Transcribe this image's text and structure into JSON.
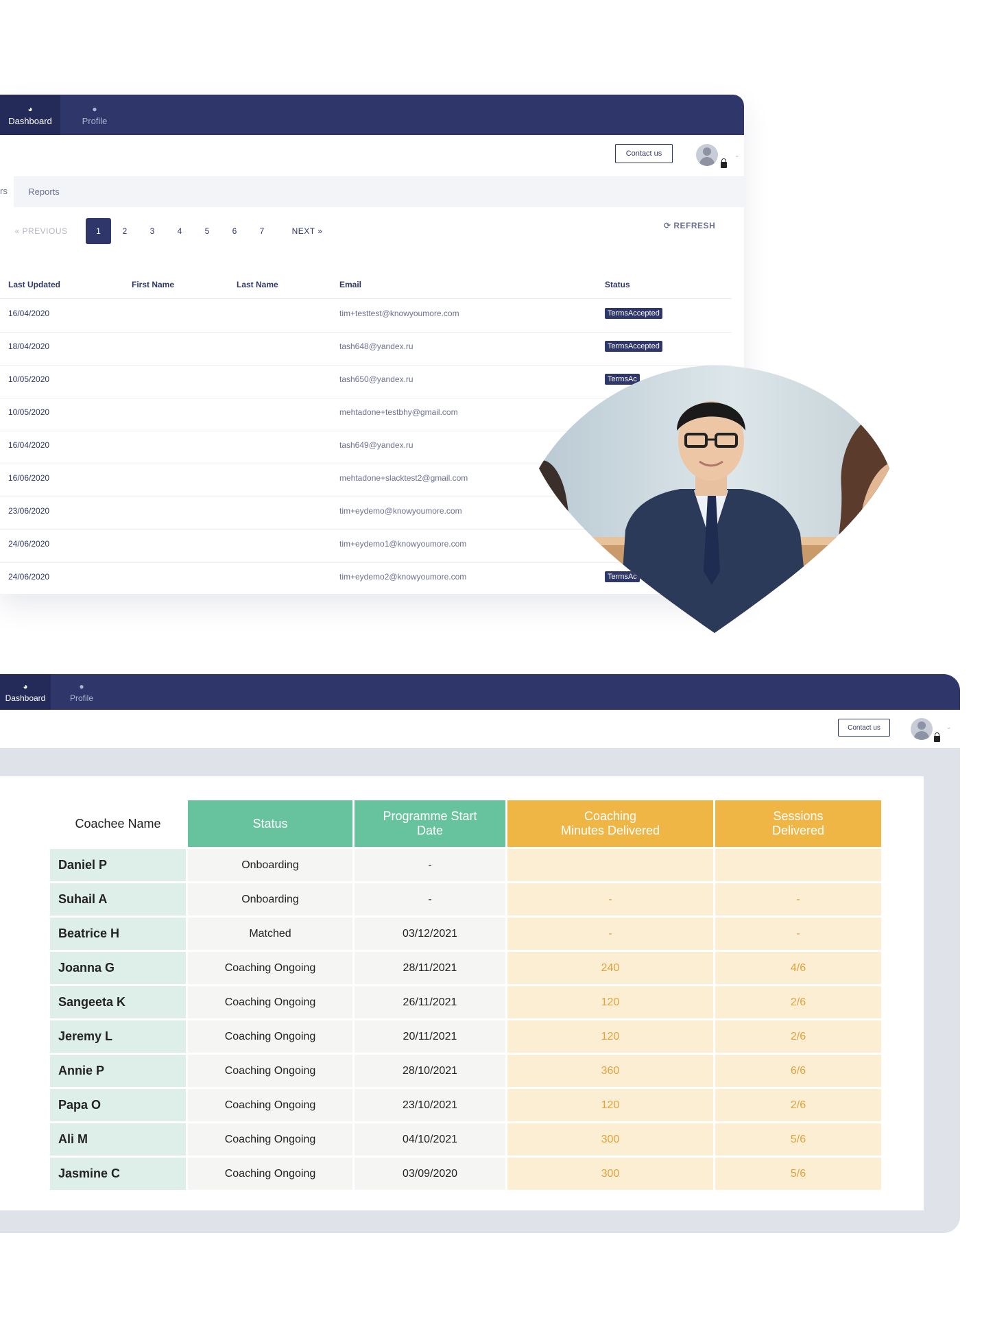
{
  "admin": {
    "nav": {
      "dashboard": "Dashboard",
      "profile": "Profile"
    },
    "header": {
      "contact": "Contact us"
    },
    "tabs": {
      "left_partial": "rs",
      "reports": "Reports"
    },
    "pager": {
      "prev": "«  PREVIOUS",
      "pages": [
        "1",
        "2",
        "3",
        "4",
        "5",
        "6",
        "7"
      ],
      "next": "NEXT  »",
      "refresh": "⟳ REFRESH"
    },
    "columns": [
      "Last Updated",
      "First Name",
      "Last Name",
      "Email",
      "Status"
    ],
    "rows": [
      {
        "date": "16/04/2020",
        "email": "tim+testtest@knowyoumore.com",
        "status": "TermsAccepted"
      },
      {
        "date": "18/04/2020",
        "email": "tash648@yandex.ru",
        "status": "TermsAccepted"
      },
      {
        "date": "10/05/2020",
        "email": "tash650@yandex.ru",
        "status": "TermsAc"
      },
      {
        "date": "10/05/2020",
        "email": "mehtadone+testbhy@gmail.com",
        "status": ""
      },
      {
        "date": "16/04/2020",
        "email": "tash649@yandex.ru",
        "status": ""
      },
      {
        "date": "16/06/2020",
        "email": "mehtadone+slacktest2@gmail.com",
        "status": ""
      },
      {
        "date": "23/06/2020",
        "email": "tim+eydemo@knowyoumore.com",
        "status": ""
      },
      {
        "date": "24/06/2020",
        "email": "tim+eydemo1@knowyoumore.com",
        "status": ""
      },
      {
        "date": "24/06/2020",
        "email": "tim+eydemo2@knowyoumore.com",
        "status": "TermsAc"
      }
    ]
  },
  "coach": {
    "nav": {
      "dashboard": "Dashboard",
      "profile": "Profile"
    },
    "header": {
      "contact": "Contact us"
    },
    "columns": {
      "name": "Coachee Name",
      "status": "Status",
      "start_1": "Programme Start",
      "start_2": "Date",
      "minutes_1": "Coaching",
      "minutes_2": "Minutes Delivered",
      "sessions_1": "Sessions",
      "sessions_2": "Delivered"
    },
    "rows": [
      {
        "name": "Daniel P",
        "status": "Onboarding",
        "start": "-",
        "minutes": "",
        "sessions": ""
      },
      {
        "name": "Suhail A",
        "status": "Onboarding",
        "start": "-",
        "minutes": "-",
        "sessions": "-"
      },
      {
        "name": "Beatrice H",
        "status": "Matched",
        "start": "03/12/2021",
        "minutes": "-",
        "sessions": "-"
      },
      {
        "name": "Joanna G",
        "status": "Coaching Ongoing",
        "start": "28/11/2021",
        "minutes": "240",
        "sessions": "4/6"
      },
      {
        "name": "Sangeeta K",
        "status": "Coaching Ongoing",
        "start": "26/11/2021",
        "minutes": "120",
        "sessions": "2/6"
      },
      {
        "name": "Jeremy L",
        "status": "Coaching Ongoing",
        "start": "20/11/2021",
        "minutes": "120",
        "sessions": "2/6"
      },
      {
        "name": "Annie P",
        "status": "Coaching Ongoing",
        "start": "28/10/2021",
        "minutes": "360",
        "sessions": "6/6"
      },
      {
        "name": "Papa O",
        "status": "Coaching Ongoing",
        "start": "23/10/2021",
        "minutes": "120",
        "sessions": "2/6"
      },
      {
        "name": "Ali M",
        "status": "Coaching Ongoing",
        "start": "04/10/2021",
        "minutes": "300",
        "sessions": "5/6"
      },
      {
        "name": "Jasmine C",
        "status": "Coaching Ongoing",
        "start": "03/09/2020",
        "minutes": "300",
        "sessions": "5/6"
      }
    ]
  },
  "colors": {
    "navy": "#2f376a",
    "green_header": "#67c39e",
    "amber_header": "#efb646",
    "name_cell": "#deefea",
    "amber_cell": "#fbeed3",
    "amber_text": "#e3a13c"
  }
}
